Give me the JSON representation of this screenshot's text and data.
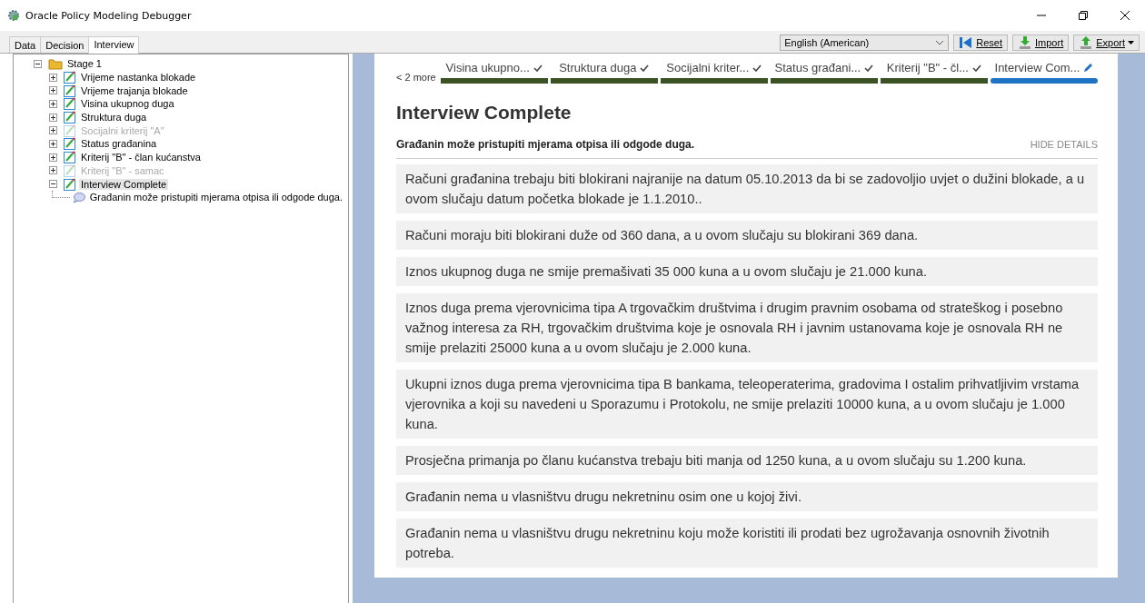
{
  "window": {
    "title": "Oracle Policy Modeling Debugger"
  },
  "tabs": [
    {
      "label": "Data",
      "selected": false
    },
    {
      "label": "Decision",
      "selected": false
    },
    {
      "label": "Interview",
      "selected": true
    }
  ],
  "toolbar": {
    "language": "English (American)",
    "buttons": [
      {
        "label": "Reset",
        "kind": "reset"
      },
      {
        "label": "Import",
        "kind": "import"
      },
      {
        "label": "Export",
        "kind": "export"
      }
    ]
  },
  "tree": [
    {
      "label": "Stage 1",
      "kind": "folder",
      "expanded": true,
      "disabled": false,
      "selected": false,
      "children": [
        {
          "label": "Vrijeme nastanka blokade",
          "kind": "screen",
          "expanded": false,
          "disabled": false,
          "selected": false
        },
        {
          "label": "Vrijeme trajanja blokade",
          "kind": "screen",
          "expanded": false,
          "disabled": false,
          "selected": false
        },
        {
          "label": "Visina ukupnog duga",
          "kind": "screen",
          "expanded": false,
          "disabled": false,
          "selected": false
        },
        {
          "label": "Struktura duga",
          "kind": "screen",
          "expanded": false,
          "disabled": false,
          "selected": false
        },
        {
          "label": "Socijalni kriterij \"A\"",
          "kind": "screen",
          "expanded": false,
          "disabled": true,
          "selected": false
        },
        {
          "label": "Status građanina",
          "kind": "screen",
          "expanded": false,
          "disabled": false,
          "selected": false
        },
        {
          "label": "Kriterij \"B\" - član kućanstva",
          "kind": "screen",
          "expanded": false,
          "disabled": false,
          "selected": false
        },
        {
          "label": "Kriterij \"B\" - samac",
          "kind": "screen",
          "expanded": false,
          "disabled": true,
          "selected": false
        },
        {
          "label": "Interview Complete",
          "kind": "screen",
          "expanded": true,
          "disabled": false,
          "selected": true,
          "children": [
            {
              "label": "Građanin može pristupiti mjerama otpisa ili odgode duga.",
              "kind": "goal",
              "disabled": false,
              "selected": false
            }
          ]
        }
      ]
    }
  ],
  "interview": {
    "more": "< 2 more",
    "steps": [
      {
        "label": "Visina ukupno...",
        "kind": "done"
      },
      {
        "label": "Struktura duga",
        "kind": "done"
      },
      {
        "label": "Socijalni kriter...",
        "kind": "done"
      },
      {
        "label": "Status građani...",
        "kind": "done"
      },
      {
        "label": "Kriterij \"B\" - čl...",
        "kind": "done"
      },
      {
        "label": "Interview Com...",
        "kind": "current"
      }
    ],
    "heading": "Interview Complete",
    "goal": "Građanin može pristupiti mjerama otpisa ili odgode duga.",
    "hide_details": "HIDE DETAILS",
    "details": [
      "Računi građanina trebaju biti blokirani najranije na datum 05.10.2013 da bi se zadovoljio uvjet o dužini blokade, a u ovom slučaju datum početka blokade je 1.1.2010..",
      "Računi moraju biti blokirani duže od 360 dana, a u ovom slučaju su blokirani 369 dana.",
      "Iznos ukupnog duga ne smije premašivati 35 000 kuna a u ovom slučaju je 21.000 kuna.",
      "Iznos duga prema vjerovnicima tipa A trgovačkim društvima i drugim pravnim osobama od strateškog i posebno važnog interesa za RH, trgovačkim društvima koje je osnovala RH i javnim ustanovama koje je osnovala RH ne smije prelaziti 25000 kuna a u ovom slučaju je 2.000 kuna.",
      "Ukupni iznos duga prema vjerovnicima tipa B bankama, teleoperaterima, gradovima I ostalim prihvatljivim vrstama vjerovnika a koji su navedeni u Sporazumu i Protokolu, ne smije prelaziti 10000 kuna, a u ovom slučaju je 1.000 kuna.",
      "Prosječna primanja po članu kućanstva trebaju biti manja od 1250 kuna, a u ovom slučaju su 1.200 kuna.",
      "Građanin nema u vlasništvu drugu nekretninu osim one u kojoj živi.",
      "Građanin nema u vlasništvu drugu nekretninu koju može koristiti ili prodati bez ugrožavanja osnovnih životnih potreba."
    ]
  }
}
